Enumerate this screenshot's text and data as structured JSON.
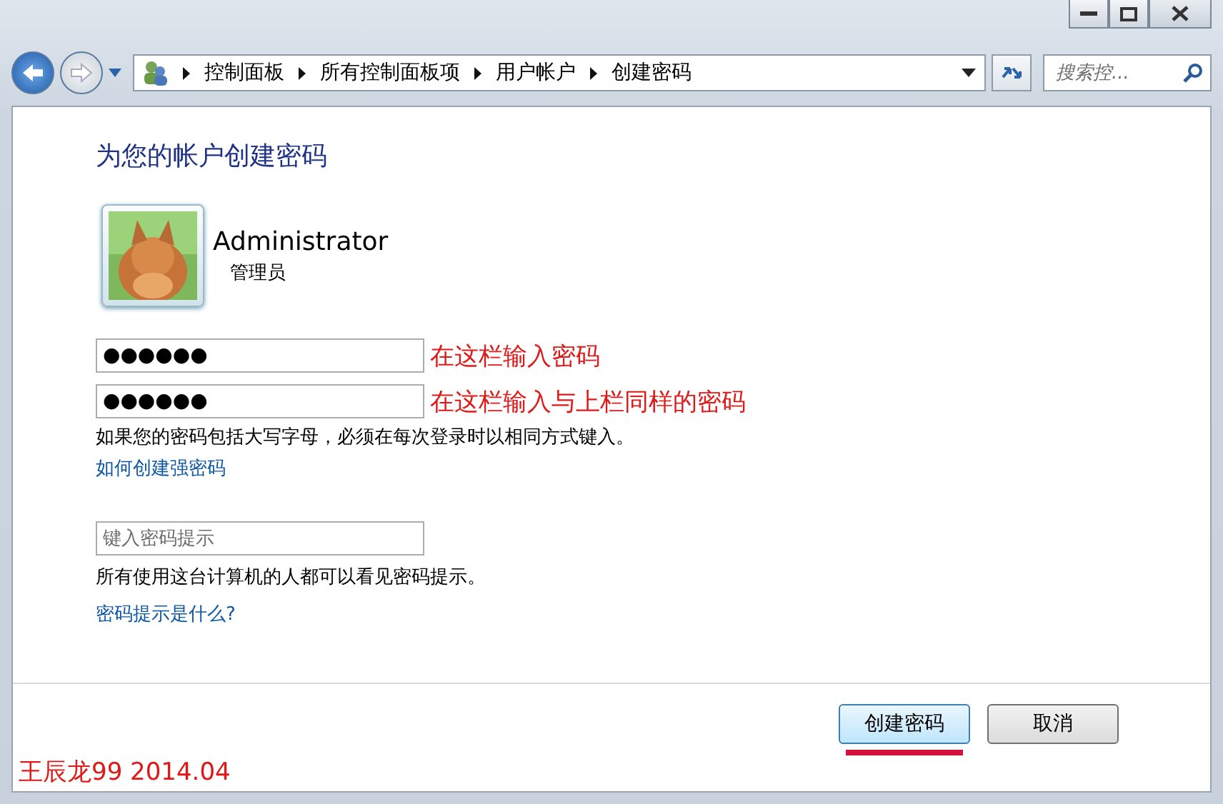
{
  "window": {
    "controls": [
      {
        "kind": "minimize"
      },
      {
        "kind": "maximize"
      },
      {
        "kind": "close"
      }
    ]
  },
  "nav": {
    "breadcrumb": [
      "控制面板",
      "所有控制面板项",
      "用户帐户",
      "创建密码"
    ],
    "search": {
      "placeholder": "搜索控..."
    }
  },
  "heading": "为您的帐户创建密码",
  "account": {
    "name": "Administrator",
    "role": "管理员"
  },
  "password_fields": [
    {
      "value": "●●●●●●",
      "annotation": "在这栏输入密码"
    },
    {
      "value": "●●●●●●",
      "annotation": "在这栏输入与上栏同样的密码"
    }
  ],
  "case_note": "如果您的密码包括大写字母，必须在每次登录时以相同方式键入。",
  "strong_link": "如何创建强密码",
  "hint_field": {
    "placeholder": "键入密码提示"
  },
  "hint_note": "所有使用这台计算机的人都可以看见密码提示。",
  "hint_link": "密码提示是什么?",
  "buttons": [
    {
      "label": "创建密码",
      "default": true,
      "underlined": true
    },
    {
      "label": "取消",
      "default": false,
      "underlined": false
    }
  ],
  "signature": "王辰龙99 2014.04"
}
